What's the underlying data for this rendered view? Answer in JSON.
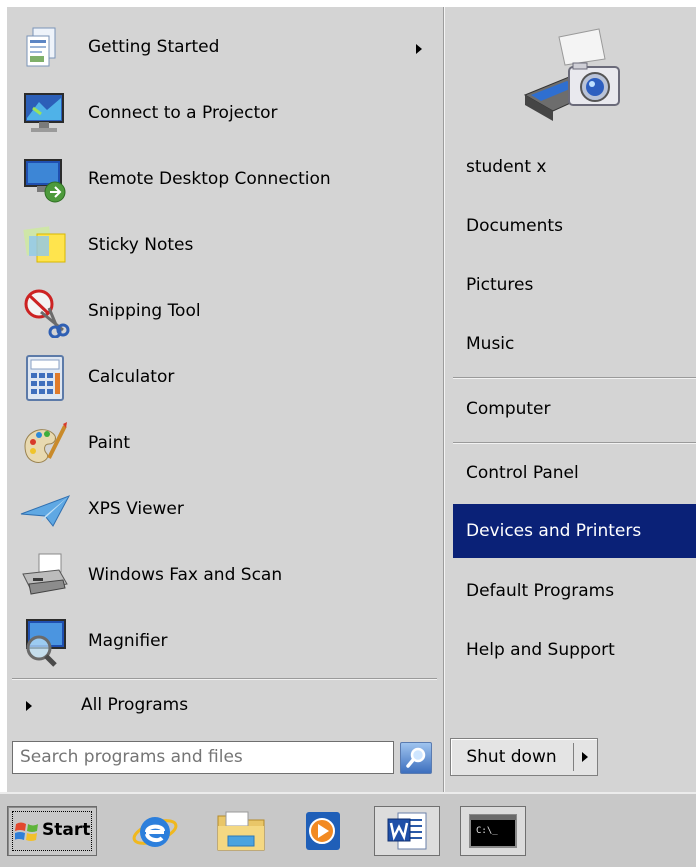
{
  "programs": [
    {
      "label": "Getting Started",
      "icon": "getting-started-icon",
      "has_submenu": true
    },
    {
      "label": "Connect to a Projector",
      "icon": "projector-icon",
      "has_submenu": false
    },
    {
      "label": "Remote Desktop Connection",
      "icon": "remote-desktop-icon",
      "has_submenu": false
    },
    {
      "label": "Sticky Notes",
      "icon": "sticky-notes-icon",
      "has_submenu": false
    },
    {
      "label": "Snipping Tool",
      "icon": "snipping-tool-icon",
      "has_submenu": false
    },
    {
      "label": "Calculator",
      "icon": "calculator-icon",
      "has_submenu": false
    },
    {
      "label": "Paint",
      "icon": "paint-icon",
      "has_submenu": false
    },
    {
      "label": "XPS Viewer",
      "icon": "xps-viewer-icon",
      "has_submenu": false
    },
    {
      "label": "Windows Fax and Scan",
      "icon": "fax-scan-icon",
      "has_submenu": false
    },
    {
      "label": "Magnifier",
      "icon": "magnifier-icon",
      "has_submenu": false
    }
  ],
  "all_programs_label": "All Programs",
  "right_items": [
    {
      "label": "student x"
    },
    {
      "label": "Documents"
    },
    {
      "label": "Pictures"
    },
    {
      "label": "Music"
    },
    {
      "label": "Computer"
    },
    {
      "label": "Control Panel"
    },
    {
      "label": "Devices and Printers",
      "selected": true
    },
    {
      "label": "Default Programs"
    },
    {
      "label": "Help and Support"
    }
  ],
  "search": {
    "placeholder": "Search programs and files",
    "value": ""
  },
  "shutdown_label": "Shut down",
  "taskbar": {
    "start_label": "Start",
    "pinned": [
      "internet-explorer-icon",
      "windows-explorer-icon",
      "media-player-icon",
      "word-icon",
      "command-prompt-icon"
    ],
    "cmd_text": "C:\\_"
  },
  "colors": {
    "menu_bg": "#d4d4d4",
    "selection_bg": "#0a2177",
    "selection_text": "#ffffff",
    "taskbar_bg": "#c8c8c8"
  }
}
